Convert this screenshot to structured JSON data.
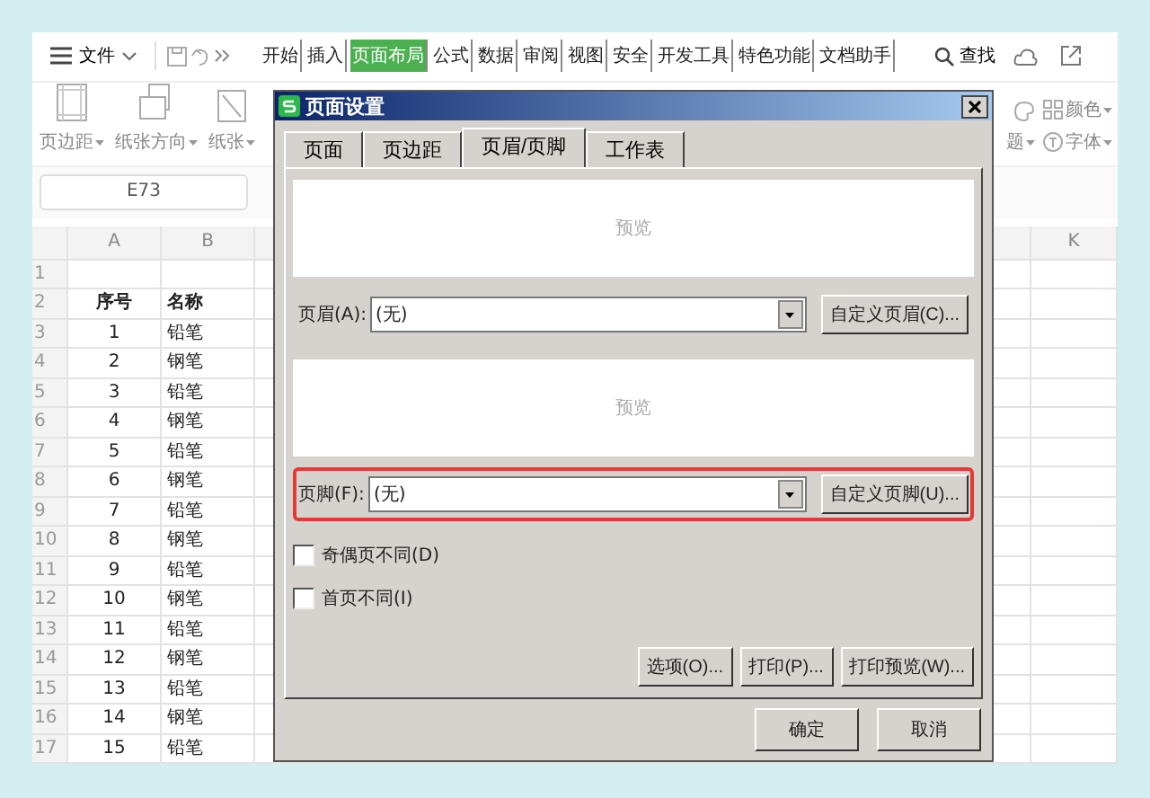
{
  "menu": {
    "file": "文件",
    "tabs": [
      {
        "label": "开始",
        "selected": false
      },
      {
        "label": "插入",
        "selected": false
      },
      {
        "label": "页面布局",
        "selected": true
      },
      {
        "label": "公式",
        "selected": false
      },
      {
        "label": "数据",
        "selected": false
      },
      {
        "label": "审阅",
        "selected": false
      },
      {
        "label": "视图",
        "selected": false
      },
      {
        "label": "安全",
        "selected": false
      },
      {
        "label": "开发工具",
        "selected": false
      },
      {
        "label": "特色功能",
        "selected": false
      },
      {
        "label": "文档助手",
        "selected": false
      }
    ],
    "search": "查找"
  },
  "ribbon": {
    "items": [
      {
        "label": "页边距",
        "kind": "margins"
      },
      {
        "label": "纸张方向",
        "kind": "orientation"
      },
      {
        "label": "纸张",
        "kind": "size"
      }
    ],
    "right_items": [
      {
        "label": "题",
        "kind": "theme"
      },
      {
        "label": "颜色",
        "kind": "colors"
      },
      {
        "label": "字体",
        "kind": "fonts"
      }
    ]
  },
  "name_box": "E73",
  "sheet": {
    "columns": [
      "A",
      "B",
      "K"
    ],
    "rows": [
      {
        "number": "1",
        "kind": "blank"
      },
      {
        "number": "2",
        "kind": "heading",
        "a": "序号",
        "b": "名称"
      },
      {
        "number": "3",
        "kind": "data",
        "a": "1",
        "b": "铅笔"
      },
      {
        "number": "4",
        "kind": "data",
        "a": "2",
        "b": "钢笔"
      },
      {
        "number": "5",
        "kind": "data",
        "a": "3",
        "b": "铅笔"
      },
      {
        "number": "6",
        "kind": "data",
        "a": "4",
        "b": "钢笔"
      },
      {
        "number": "7",
        "kind": "data",
        "a": "5",
        "b": "铅笔"
      },
      {
        "number": "8",
        "kind": "data",
        "a": "6",
        "b": "钢笔"
      },
      {
        "number": "9",
        "kind": "data",
        "a": "7",
        "b": "铅笔"
      },
      {
        "number": "10",
        "kind": "data",
        "a": "8",
        "b": "钢笔"
      },
      {
        "number": "11",
        "kind": "data",
        "a": "9",
        "b": "铅笔"
      },
      {
        "number": "12",
        "kind": "data",
        "a": "10",
        "b": "钢笔"
      },
      {
        "number": "13",
        "kind": "data",
        "a": "11",
        "b": "铅笔"
      },
      {
        "number": "14",
        "kind": "data",
        "a": "12",
        "b": "钢笔"
      },
      {
        "number": "15",
        "kind": "data",
        "a": "13",
        "b": "铅笔"
      },
      {
        "number": "16",
        "kind": "data",
        "a": "14",
        "b": "钢笔"
      },
      {
        "number": "17",
        "kind": "data",
        "a": "15",
        "b": "铅笔"
      }
    ]
  },
  "dialog": {
    "title": "页面设置",
    "tabs": [
      {
        "label": "页面",
        "selected": false
      },
      {
        "label": "页边距",
        "selected": false
      },
      {
        "label": "页眉/页脚",
        "selected": true
      },
      {
        "label": "工作表",
        "selected": false
      }
    ],
    "sections": [
      {
        "preview": "预览",
        "label": "页眉(A):",
        "value": "(无)",
        "button": "自定义页眉(C)...",
        "highlighted": false
      },
      {
        "preview": "预览",
        "label": "页脚(F):",
        "value": "(无)",
        "button": "自定义页脚(U)...",
        "highlighted": true
      }
    ],
    "checkboxes": [
      {
        "label": "奇偶页不同(D)",
        "checked": false
      },
      {
        "label": "首页不同(I)",
        "checked": false
      }
    ],
    "buttons": [
      "选项(O)...",
      "打印(P)...",
      "打印预览(W)..."
    ],
    "footer_buttons": [
      "确定",
      "取消"
    ]
  }
}
